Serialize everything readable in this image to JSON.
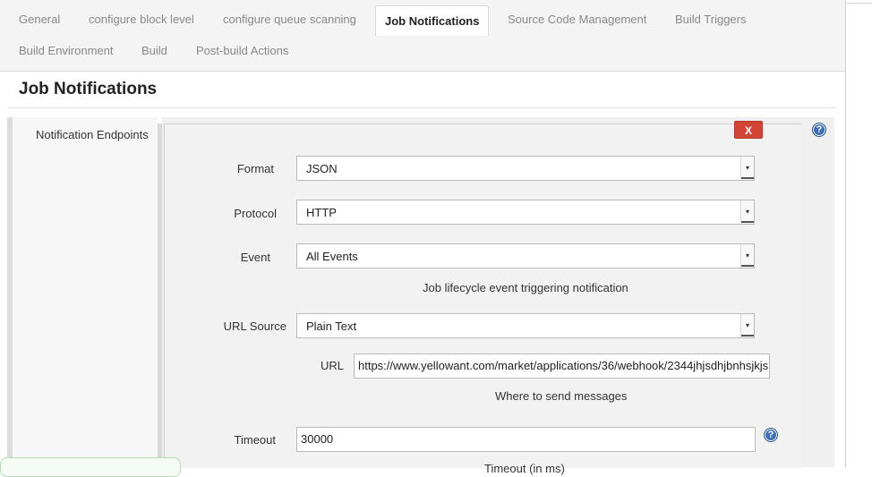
{
  "tabs": [
    {
      "label": "General"
    },
    {
      "label": "configure block level"
    },
    {
      "label": "configure queue scanning"
    },
    {
      "label": "Job Notifications",
      "active": true
    },
    {
      "label": "Source Code Management"
    },
    {
      "label": "Build Triggers"
    },
    {
      "label": "Build Environment"
    },
    {
      "label": "Build"
    },
    {
      "label": "Post-build Actions"
    }
  ],
  "section": {
    "title": "Job Notifications"
  },
  "endpoints": {
    "label": "Notification Endpoints",
    "delete_label": "X",
    "help_glyph": "?",
    "format": {
      "label": "Format",
      "value": "JSON"
    },
    "protocol": {
      "label": "Protocol",
      "value": "HTTP"
    },
    "event": {
      "label": "Event",
      "value": "All Events",
      "hint": "Job lifecycle event triggering notification"
    },
    "url_source": {
      "label": "URL Source",
      "value": "Plain Text"
    },
    "url": {
      "label": "URL",
      "value": "https://www.yellowant.com/market/applications/36/webhook/2344jhjsdhjbnhsjkjs",
      "hint": "Where to send messages"
    },
    "timeout": {
      "label": "Timeout",
      "value": "30000",
      "hint": "Timeout (in ms)"
    }
  },
  "colors": {
    "delete": "#d24536",
    "help": "#3d6eb3",
    "active_tab_bg": "#ffffff"
  }
}
